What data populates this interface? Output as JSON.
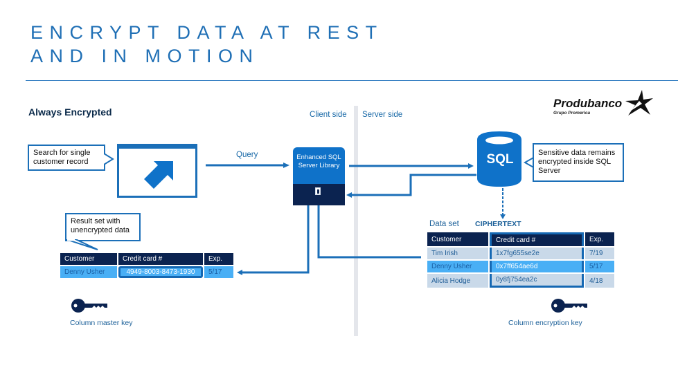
{
  "slide": {
    "title_line1": "ENCRYPT DATA AT REST",
    "title_line2": "AND IN MOTION"
  },
  "diagram": {
    "heading": "Always Encrypted",
    "client_side_label": "Client side",
    "server_side_label": "Server side",
    "search_callout": "Search for single customer record",
    "query_label": "Query",
    "library_label": "Enhanced SQL Server Library",
    "sql_label": "SQL",
    "sql_callout": "Sensitive data remains encrypted inside SQL Server",
    "result_callout": "Result set with unencrypted data",
    "dataset_label": "Data set",
    "ciphertext_label": "CIPHERTEXT",
    "column_master_key": "Column master key",
    "column_encryption_key": "Column encryption key",
    "logo": {
      "name": "Produbanco",
      "subtitle": "Grupo Promerica"
    },
    "client_table": {
      "headers": [
        "Customer",
        "Credit card #",
        "Exp."
      ],
      "rows": [
        [
          "Denny Usher",
          "4949-8003-8473-1930",
          "5/17"
        ]
      ]
    },
    "server_table": {
      "headers": [
        "Customer",
        "Credit card #",
        "Exp."
      ],
      "rows": [
        [
          "Tim Irish",
          "1x7fg655se2e",
          "7/19"
        ],
        [
          "Denny Usher",
          "0x7ff654ae6d",
          "5/17"
        ],
        [
          "Alicia Hodge",
          "0y8fj754ea2c",
          "4/18"
        ]
      ],
      "highlighted_row": 1
    },
    "colors": {
      "accent": "#1f6fb5",
      "dark_navy": "#0b2350",
      "highlight": "#49aff5",
      "light_row": "#c9d9e9"
    }
  }
}
